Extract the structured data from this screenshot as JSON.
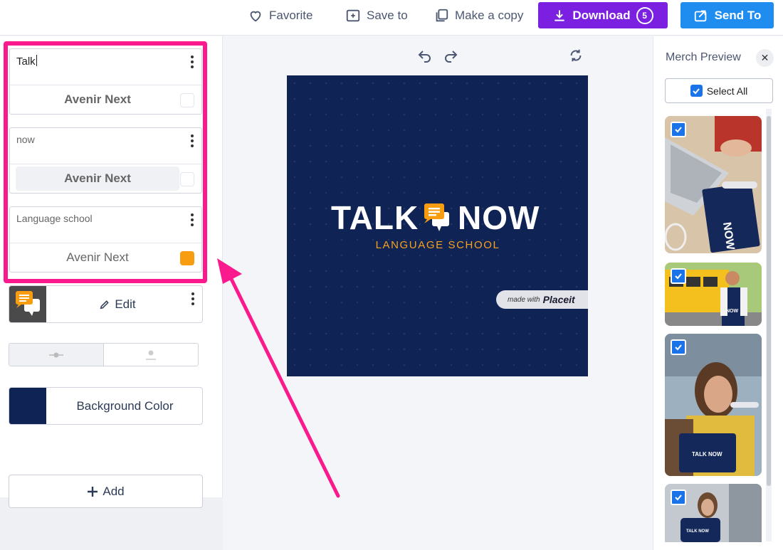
{
  "topbar": {
    "favorite_label": "Favorite",
    "save_label": "Save to",
    "copy_label": "Make a copy",
    "download_label": "Download",
    "download_count": "5",
    "send_label": "Send To"
  },
  "left_panel": {
    "text_layers": [
      {
        "text": "Talk",
        "font": "Avenir Next",
        "swatch": "white",
        "font_weight": "bold"
      },
      {
        "text": "now",
        "font": "Avenir Next",
        "swatch": "white",
        "font_weight": "bold"
      },
      {
        "text": "Language school",
        "font": "Avenir Next",
        "swatch": "orange",
        "font_weight": "normal"
      }
    ],
    "edit_label": "Edit",
    "background_label": "Background Color",
    "add_label": "Add"
  },
  "design": {
    "word1": "TALK",
    "word2": "NOW",
    "subtitle": "LANGUAGE SCHOOL",
    "made_with": "made with",
    "brand": "Placeit",
    "bg_color": "#0f2455",
    "accent_color": "#f8a21c"
  },
  "merch": {
    "title": "Merch Preview",
    "select_all_label": "Select All",
    "notebook_text": "NOW",
    "bag_text": "TALK NOW",
    "backpack_text": "TALK NOW"
  },
  "colors": {
    "download": "#7b1fe0",
    "send": "#1f8df0",
    "highlight": "#fb1a8e"
  }
}
